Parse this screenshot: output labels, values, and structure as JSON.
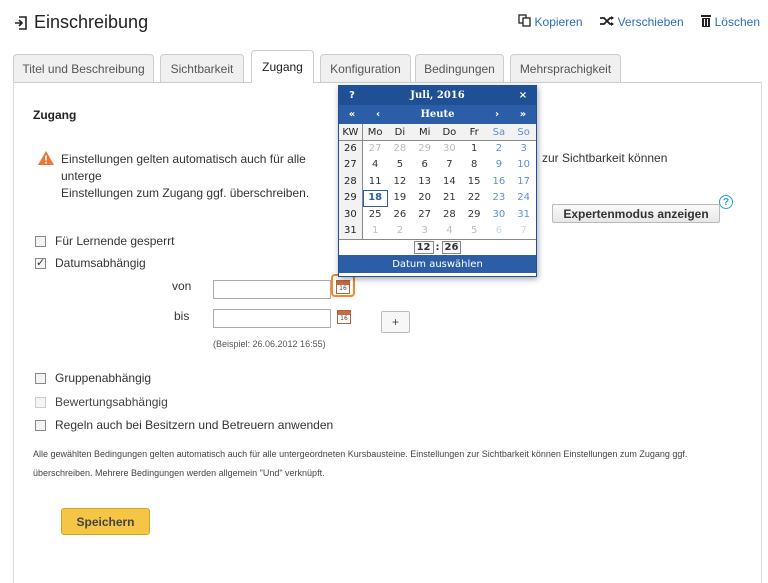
{
  "header": {
    "title": "Einschreibung",
    "actions": [
      {
        "label": "Kopieren",
        "icon": "copy-icon"
      },
      {
        "label": "Verschieben",
        "icon": "shuffle-icon"
      },
      {
        "label": "Löschen",
        "icon": "trash-icon"
      }
    ]
  },
  "tabs": [
    {
      "label": "Titel und Beschreibung"
    },
    {
      "label": "Sichtbarkeit"
    },
    {
      "label": "Zugang",
      "active": true
    },
    {
      "label": "Konfiguration"
    },
    {
      "label": "Bedingungen"
    },
    {
      "label": "Mehrsprachigkeit"
    }
  ],
  "section": {
    "title": "Zugang",
    "warning_line1": "Einstellungen gelten automatisch auch für alle unterge",
    "warning_line2": "Einstellungen zum Zugang ggf. überschreiben.",
    "warning_tail": "zur Sichtbarkeit können",
    "expert_button": "Expertenmodus anzeigen",
    "help_icon": "?"
  },
  "options": {
    "locked": {
      "label": "Für Lernende gesperrt",
      "checked": false
    },
    "date_dependent": {
      "label": "Datumsabhängig",
      "checked": true
    },
    "from_label": "von",
    "from_value": "",
    "to_label": "bis",
    "to_value": "",
    "plus": "+",
    "example": "(Beispiel: 26.06.2012 16:55)",
    "group_dependent": {
      "label": "Gruppenabhängig",
      "checked": false
    },
    "assessment_dependent": {
      "label": "Bewertungsabhängig",
      "checked": false
    },
    "owners_rule": {
      "label": "Regeln auch bei Besitzern und Betreuern anwenden",
      "checked": false
    }
  },
  "footnote": "Alle gewählten Bedingungen gelten automatisch auch für alle untergeordneten Kursbausteine. Einstellungen zur Sichtbarkeit können Einstellungen zum Zugang ggf. überschreiben. Mehrere Bedingungen werden allgemein \"Und\" verknüpft.",
  "save_button": "Speichern",
  "calendar": {
    "help": "?",
    "month_year": "Juli, 2016",
    "close": "×",
    "prev_year": "«",
    "prev_month": "‹",
    "today": "Heute",
    "next_month": "›",
    "next_year": "»",
    "headers": [
      "KW",
      "Mo",
      "Di",
      "Mi",
      "Do",
      "Fr",
      "Sa",
      "So"
    ],
    "weeks": [
      {
        "kw": "26",
        "days": [
          "27",
          "28",
          "29",
          "30",
          "1",
          "2",
          "3"
        ]
      },
      {
        "kw": "27",
        "days": [
          "4",
          "5",
          "6",
          "7",
          "8",
          "9",
          "10"
        ]
      },
      {
        "kw": "28",
        "days": [
          "11",
          "12",
          "13",
          "14",
          "15",
          "16",
          "17"
        ]
      },
      {
        "kw": "29",
        "days": [
          "18",
          "19",
          "20",
          "21",
          "22",
          "23",
          "24"
        ]
      },
      {
        "kw": "30",
        "days": [
          "25",
          "26",
          "27",
          "28",
          "29",
          "30",
          "31"
        ]
      },
      {
        "kw": "31",
        "days": [
          "1",
          "2",
          "3",
          "4",
          "5",
          "6",
          "7"
        ]
      }
    ],
    "current_day": "18",
    "hour": "12",
    "minute": "26",
    "footer": "Datum auswählen"
  }
}
